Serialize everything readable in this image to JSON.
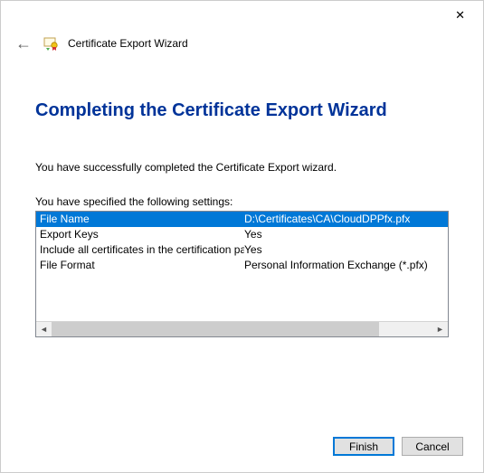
{
  "window": {
    "wizard_name": "Certificate Export Wizard"
  },
  "page": {
    "heading": "Completing the Certificate Export Wizard",
    "intro": "You have successfully completed the Certificate Export wizard.",
    "settings_label": "You have specified the following settings:",
    "rows": [
      {
        "key": "File Name",
        "value": "D:\\Certificates\\CA\\CloudDPPfx.pfx",
        "selected": true
      },
      {
        "key": "Export Keys",
        "value": "Yes",
        "selected": false
      },
      {
        "key": "Include all certificates in the certification path",
        "value": "Yes",
        "selected": false
      },
      {
        "key": "File Format",
        "value": "Personal Information Exchange (*.pfx)",
        "selected": false
      }
    ]
  },
  "buttons": {
    "finish": "Finish",
    "cancel": "Cancel"
  }
}
